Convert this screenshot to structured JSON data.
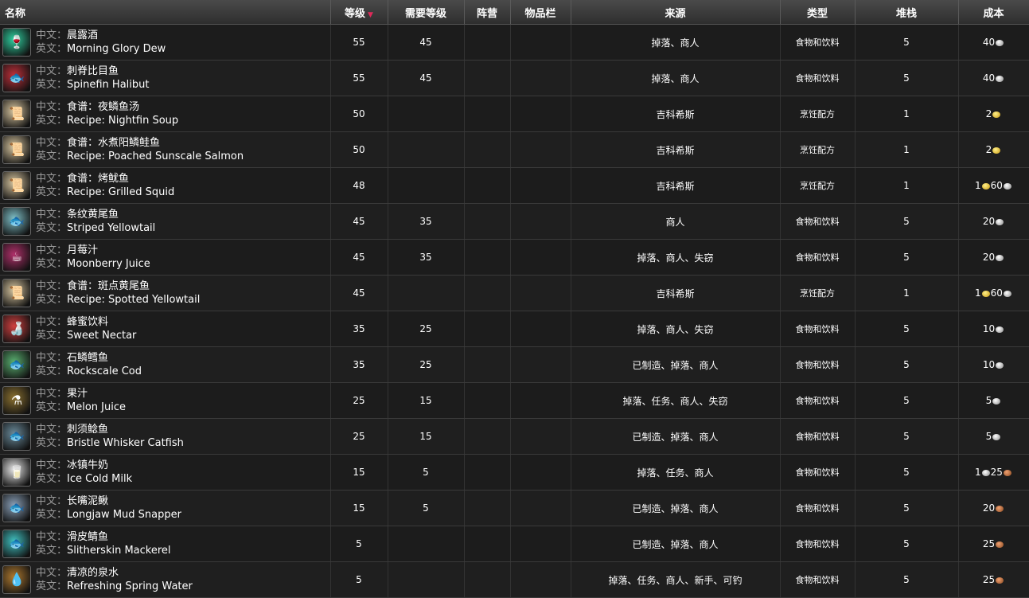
{
  "headers": {
    "name": "名称",
    "level": "等级",
    "req_level": "需要等级",
    "faction": "阵营",
    "slot": "物品栏",
    "source": "来源",
    "type": "类型",
    "stack": "堆栈",
    "cost": "成本"
  },
  "labels": {
    "cn": "中文：",
    "en": "英文："
  },
  "rows": [
    {
      "cn": "晨露酒",
      "en": "Morning Glory Dew",
      "level": "55",
      "req": "45",
      "source": "掉落、商人",
      "type": "食物和饮料",
      "stack": "5",
      "cost": [
        {
          "v": "40",
          "c": "silver"
        }
      ],
      "icon": "goblet-icon",
      "icon_color": "#2fd0a0"
    },
    {
      "cn": "刺脊比目鱼",
      "en": "Spinefin Halibut",
      "level": "55",
      "req": "45",
      "source": "掉落、商人",
      "type": "食物和饮料",
      "stack": "5",
      "cost": [
        {
          "v": "40",
          "c": "silver"
        }
      ],
      "icon": "fish-icon",
      "icon_color": "#c0303a"
    },
    {
      "cn": "食谱：夜鳞鱼汤",
      "en": "Recipe: Nightfin Soup",
      "level": "50",
      "req": "",
      "source": "吉科希斯",
      "type": "烹饪配方",
      "stack": "1",
      "cost": [
        {
          "v": "2",
          "c": "gold"
        }
      ],
      "icon": "scroll-icon",
      "icon_color": "#d8c6a0"
    },
    {
      "cn": "食谱：水煮阳鳞鲑鱼",
      "en": "Recipe: Poached Sunscale Salmon",
      "level": "50",
      "req": "",
      "source": "吉科希斯",
      "type": "烹饪配方",
      "stack": "1",
      "cost": [
        {
          "v": "2",
          "c": "gold"
        }
      ],
      "icon": "scroll-icon",
      "icon_color": "#d8c6a0"
    },
    {
      "cn": "食谱：烤鱿鱼",
      "en": "Recipe: Grilled Squid",
      "level": "48",
      "req": "",
      "source": "吉科希斯",
      "type": "烹饪配方",
      "stack": "1",
      "cost": [
        {
          "v": "1",
          "c": "gold"
        },
        {
          "v": "60",
          "c": "silver"
        }
      ],
      "icon": "scroll-icon",
      "icon_color": "#d8c6a0"
    },
    {
      "cn": "条纹黄尾鱼",
      "en": "Striped Yellowtail",
      "level": "45",
      "req": "35",
      "source": "商人",
      "type": "食物和饮料",
      "stack": "5",
      "cost": [
        {
          "v": "20",
          "c": "silver"
        }
      ],
      "icon": "fish-icon",
      "icon_color": "#7fc0c8"
    },
    {
      "cn": "月莓汁",
      "en": "Moonberry Juice",
      "level": "45",
      "req": "35",
      "source": "掉落、商人、失窃",
      "type": "食物和饮料",
      "stack": "5",
      "cost": [
        {
          "v": "20",
          "c": "silver"
        }
      ],
      "icon": "cup-icon",
      "icon_color": "#b0306a"
    },
    {
      "cn": "食谱：斑点黄尾鱼",
      "en": "Recipe: Spotted Yellowtail",
      "level": "45",
      "req": "",
      "source": "吉科希斯",
      "type": "烹饪配方",
      "stack": "1",
      "cost": [
        {
          "v": "1",
          "c": "gold"
        },
        {
          "v": "60",
          "c": "silver"
        }
      ],
      "icon": "scroll-icon",
      "icon_color": "#d8c6a0"
    },
    {
      "cn": "蜂蜜饮料",
      "en": "Sweet Nectar",
      "level": "35",
      "req": "25",
      "source": "掉落、商人、失窃",
      "type": "食物和饮料",
      "stack": "5",
      "cost": [
        {
          "v": "10",
          "c": "silver"
        }
      ],
      "icon": "bottle-icon",
      "icon_color": "#d04040"
    },
    {
      "cn": "石鳞鳕鱼",
      "en": "Rockscale Cod",
      "level": "35",
      "req": "25",
      "source": "已制造、掉落、商人",
      "type": "食物和饮料",
      "stack": "5",
      "cost": [
        {
          "v": "10",
          "c": "silver"
        }
      ],
      "icon": "fish-icon",
      "icon_color": "#5ab070"
    },
    {
      "cn": "果汁",
      "en": "Melon Juice",
      "level": "25",
      "req": "15",
      "source": "掉落、任务、商人、失窃",
      "type": "食物和饮料",
      "stack": "5",
      "cost": [
        {
          "v": "5",
          "c": "silver"
        }
      ],
      "icon": "flask-icon",
      "icon_color": "#8a7030"
    },
    {
      "cn": "刺须鲶鱼",
      "en": "Bristle Whisker Catfish",
      "level": "25",
      "req": "15",
      "source": "已制造、掉落、商人",
      "type": "食物和饮料",
      "stack": "5",
      "cost": [
        {
          "v": "5",
          "c": "silver"
        }
      ],
      "icon": "fish-icon",
      "icon_color": "#6a8a9a"
    },
    {
      "cn": "冰镇牛奶",
      "en": "Ice Cold Milk",
      "level": "15",
      "req": "5",
      "source": "掉落、任务、商人",
      "type": "食物和饮料",
      "stack": "5",
      "cost": [
        {
          "v": "1",
          "c": "silver"
        },
        {
          "v": "25",
          "c": "copper"
        }
      ],
      "icon": "milk-icon",
      "icon_color": "#e8e8e8"
    },
    {
      "cn": "长嘴泥鳅",
      "en": "Longjaw Mud Snapper",
      "level": "15",
      "req": "5",
      "source": "已制造、掉落、商人",
      "type": "食物和饮料",
      "stack": "5",
      "cost": [
        {
          "v": "20",
          "c": "copper"
        }
      ],
      "icon": "fish-icon",
      "icon_color": "#8aa0b8"
    },
    {
      "cn": "滑皮鲭鱼",
      "en": "Slitherskin Mackerel",
      "level": "5",
      "req": "",
      "source": "已制造、掉落、商人",
      "type": "食物和饮料",
      "stack": "5",
      "cost": [
        {
          "v": "25",
          "c": "copper"
        }
      ],
      "icon": "fish-icon",
      "icon_color": "#40c0c0"
    },
    {
      "cn": "清凉的泉水",
      "en": "Refreshing Spring Water",
      "level": "5",
      "req": "",
      "source": "掉落、任务、商人、新手、可钓",
      "type": "食物和饮料",
      "stack": "5",
      "cost": [
        {
          "v": "25",
          "c": "copper"
        }
      ],
      "icon": "waterskin-icon",
      "icon_color": "#b07a30"
    }
  ]
}
